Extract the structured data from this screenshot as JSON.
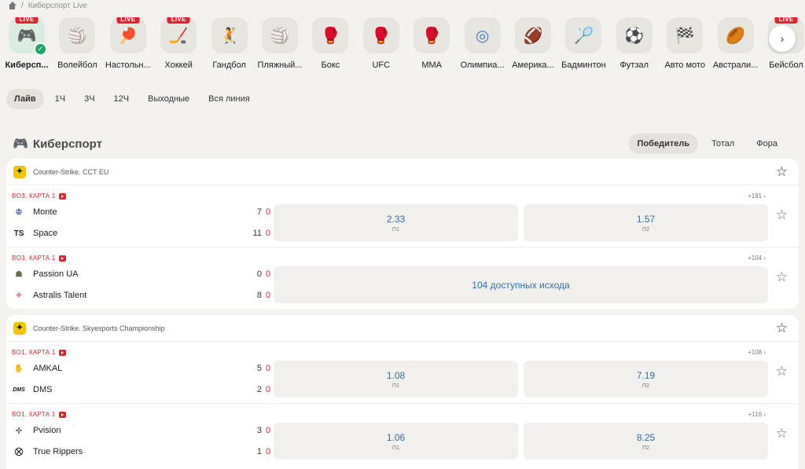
{
  "breadcrumb": {
    "current": "Киберспорт Live"
  },
  "sports": [
    {
      "name": "Киберсп...",
      "live": true,
      "active": true,
      "icon": "gamepad-icon",
      "color": "#3a3a3a"
    },
    {
      "name": "Волейбол",
      "live": false,
      "icon": "volleyball-icon",
      "color": "#f2b705"
    },
    {
      "name": "Настольн...",
      "live": true,
      "icon": "table-tennis-icon",
      "color": "#e3242b"
    },
    {
      "name": "Хоккей",
      "live": true,
      "icon": "hockey-puck-icon",
      "color": "#2a2a2a"
    },
    {
      "name": "Гандбол",
      "live": false,
      "icon": "handball-icon",
      "color": "#1f52a8"
    },
    {
      "name": "Пляжный...",
      "live": false,
      "icon": "beach-volleyball-icon",
      "color": "#e88f2a"
    },
    {
      "name": "Бокс",
      "live": false,
      "icon": "boxing-glove-icon",
      "color": "#d62d2d"
    },
    {
      "name": "UFC",
      "live": false,
      "icon": "ufc-glove-icon",
      "color": "#555555"
    },
    {
      "name": "MMA",
      "live": false,
      "icon": "mma-glove-icon",
      "color": "#c9302c"
    },
    {
      "name": "Олимпиа...",
      "live": false,
      "icon": "olympic-rings-icon",
      "color": "#3b7dd8"
    },
    {
      "name": "Америка...",
      "live": false,
      "icon": "american-football-icon",
      "color": "#8a4b25"
    },
    {
      "name": "Бадминтон",
      "live": false,
      "icon": "shuttlecock-icon",
      "color": "#d9d9d9"
    },
    {
      "name": "Футзал",
      "live": false,
      "icon": "futsal-ball-icon",
      "color": "#79b82b"
    },
    {
      "name": "Авто мото",
      "live": false,
      "icon": "racing-flags-icon",
      "color": "#444444"
    },
    {
      "name": "Австрали...",
      "live": false,
      "icon": "aussie-football-icon",
      "color": "#c0392b"
    },
    {
      "name": "Бейсбол",
      "live": true,
      "icon": "baseball-icon",
      "color": "#eeeeee"
    }
  ],
  "period_tabs": [
    "Лайв",
    "1Ч",
    "3Ч",
    "12Ч",
    "Выходные",
    "Вся линия"
  ],
  "section": {
    "title": "Киберспорт",
    "icon": "gamepad-icon"
  },
  "market_tabs": [
    "Победитель",
    "Тотал",
    "Фора"
  ],
  "tournaments": [
    {
      "name": "Counter-Strike. CCT EU",
      "matches": [
        {
          "status": "BO3, КАРТА 1",
          "more": "+191 ›",
          "team1": {
            "name": "Monte",
            "score": "7",
            "map": "0",
            "logo": "monte-logo"
          },
          "team2": {
            "name": "Space",
            "score": "11",
            "map": "0",
            "logo": "space-logo"
          },
          "odds": [
            {
              "value": "2.33",
              "label": "П1"
            },
            {
              "value": "1.57",
              "label": "П2"
            }
          ]
        },
        {
          "status": "BO3, КАРТА 1",
          "more": "+104 ›",
          "team1": {
            "name": "Passion UA",
            "score": "0",
            "map": "0",
            "logo": "passion-ua-logo"
          },
          "team2": {
            "name": "Astralis Talent",
            "score": "8",
            "map": "0",
            "logo": "astralis-logo"
          },
          "odds_wide": "104 доступных исхода"
        }
      ]
    },
    {
      "name": "Counter-Strike. Skyesports Championship",
      "matches": [
        {
          "status": "BO1, КАРТА 1",
          "more": "+108 ›",
          "team1": {
            "name": "AMKAL",
            "score": "5",
            "map": "0",
            "logo": "amkal-logo"
          },
          "team2": {
            "name": "DMS",
            "score": "2",
            "map": "0",
            "logo": "dms-logo"
          },
          "odds": [
            {
              "value": "1.08",
              "label": "П1"
            },
            {
              "value": "7.19",
              "label": "П2"
            }
          ]
        },
        {
          "status": "BO1, КАРТА 1",
          "more": "+116 ›",
          "team1": {
            "name": "Pvision",
            "score": "3",
            "map": "0",
            "logo": "pvision-logo"
          },
          "team2": {
            "name": "True Rippers",
            "score": "1",
            "map": "0",
            "logo": "true-rippers-logo"
          },
          "odds": [
            {
              "value": "1.06",
              "label": "П1"
            },
            {
              "value": "8.25",
              "label": "П2"
            }
          ]
        }
      ]
    }
  ]
}
